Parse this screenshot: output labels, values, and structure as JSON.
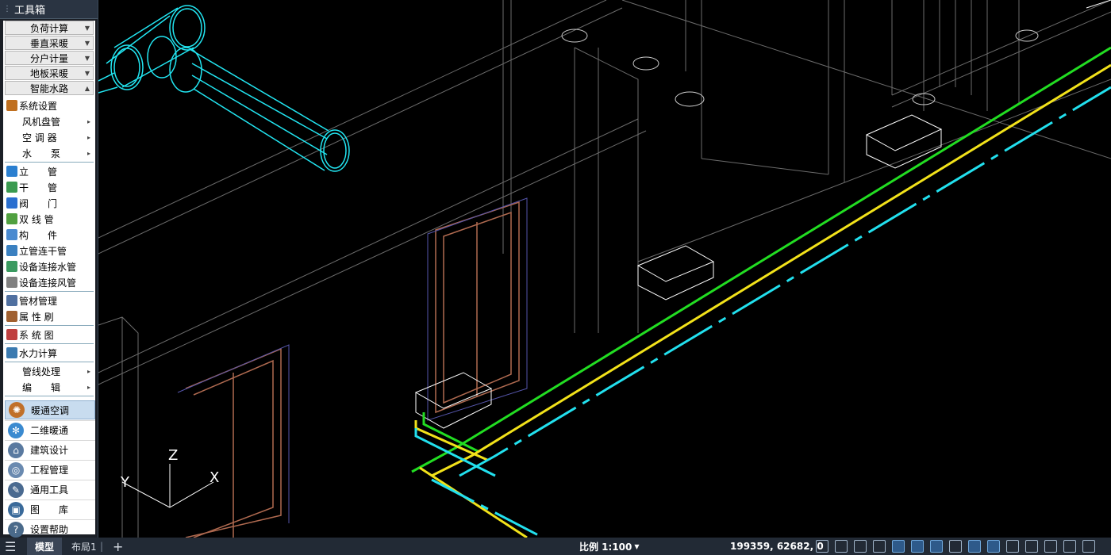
{
  "sidebar": {
    "title": "工具箱",
    "submenus": [
      "负荷计算",
      "垂直采暖",
      "分户计量",
      "地板采暖",
      "智能水路"
    ],
    "items": [
      {
        "label": "系统设置",
        "icon": "gear-icon",
        "color": "#c07020",
        "arrow": false
      },
      {
        "label": "风机盘管",
        "icon": "",
        "color": "",
        "arrow": true
      },
      {
        "label": "空 调 器",
        "icon": "",
        "color": "",
        "arrow": true
      },
      {
        "label": "水　　泵",
        "icon": "",
        "color": "",
        "arrow": true
      },
      {
        "label": "立　　管",
        "icon": "riser-icon",
        "color": "#2a7fd0",
        "arrow": false
      },
      {
        "label": "干　　管",
        "icon": "pipe-icon",
        "color": "#3a9a50",
        "arrow": false
      },
      {
        "label": "阀　　门",
        "icon": "valve-icon",
        "color": "#2a6fd0",
        "arrow": false
      },
      {
        "label": "双 线 管",
        "icon": "double-pipe-icon",
        "color": "#50a040",
        "arrow": false
      },
      {
        "label": "构　　件",
        "icon": "component-icon",
        "color": "#4a8ad0",
        "arrow": false
      },
      {
        "label": "立管连干管",
        "icon": "riser-connect-icon",
        "color": "#3a80c0",
        "arrow": false
      },
      {
        "label": "设备连接水管",
        "icon": "equip-water-icon",
        "color": "#3a9a60",
        "arrow": false
      },
      {
        "label": "设备连接风管",
        "icon": "equip-air-icon",
        "color": "#808080",
        "arrow": false
      },
      {
        "label": "管材管理",
        "icon": "material-icon",
        "color": "#5070a0",
        "arrow": false
      },
      {
        "label": "属 性 刷",
        "icon": "brush-icon",
        "color": "#a06030",
        "arrow": false
      },
      {
        "label": "系 统 图",
        "icon": "system-diagram-icon",
        "color": "#c04040",
        "arrow": false
      },
      {
        "label": "水力计算",
        "icon": "hydraulic-icon",
        "color": "#3a7ab0",
        "arrow": false
      },
      {
        "label": "管线处理",
        "icon": "",
        "color": "",
        "arrow": true
      },
      {
        "label": "编　　辑",
        "icon": "",
        "color": "",
        "arrow": true
      }
    ],
    "modules": [
      {
        "label": "暖通空调",
        "icon": "hvac-icon",
        "color": "#c0702a",
        "glyph": "✺"
      },
      {
        "label": "二维暖通",
        "icon": "fan-icon",
        "color": "#3a8ad0",
        "glyph": "✻"
      },
      {
        "label": "建筑设计",
        "icon": "building-icon",
        "color": "#5a7aa0",
        "glyph": "⌂"
      },
      {
        "label": "工程管理",
        "icon": "project-icon",
        "color": "#6a8ab0",
        "glyph": "◎"
      },
      {
        "label": "通用工具",
        "icon": "tools-icon",
        "color": "#4a6a90",
        "glyph": "✎"
      },
      {
        "label": "图　　库",
        "icon": "library-icon",
        "color": "#3a6a9a",
        "glyph": "▣"
      },
      {
        "label": "设置帮助",
        "icon": "help-icon",
        "color": "#4a6a8a",
        "glyph": "?"
      }
    ]
  },
  "axis": {
    "z": "Z",
    "y": "Y",
    "x": "X"
  },
  "status": {
    "model_tab": "模型",
    "layout_tab": "布局1",
    "add": "+",
    "scale": "比例 1:100",
    "coords": "199359, 62682, 0"
  },
  "colors": {
    "green": "#22dd22",
    "yellow": "#f2e21a",
    "cyan": "#22e0ee",
    "door": "#b06a50"
  }
}
